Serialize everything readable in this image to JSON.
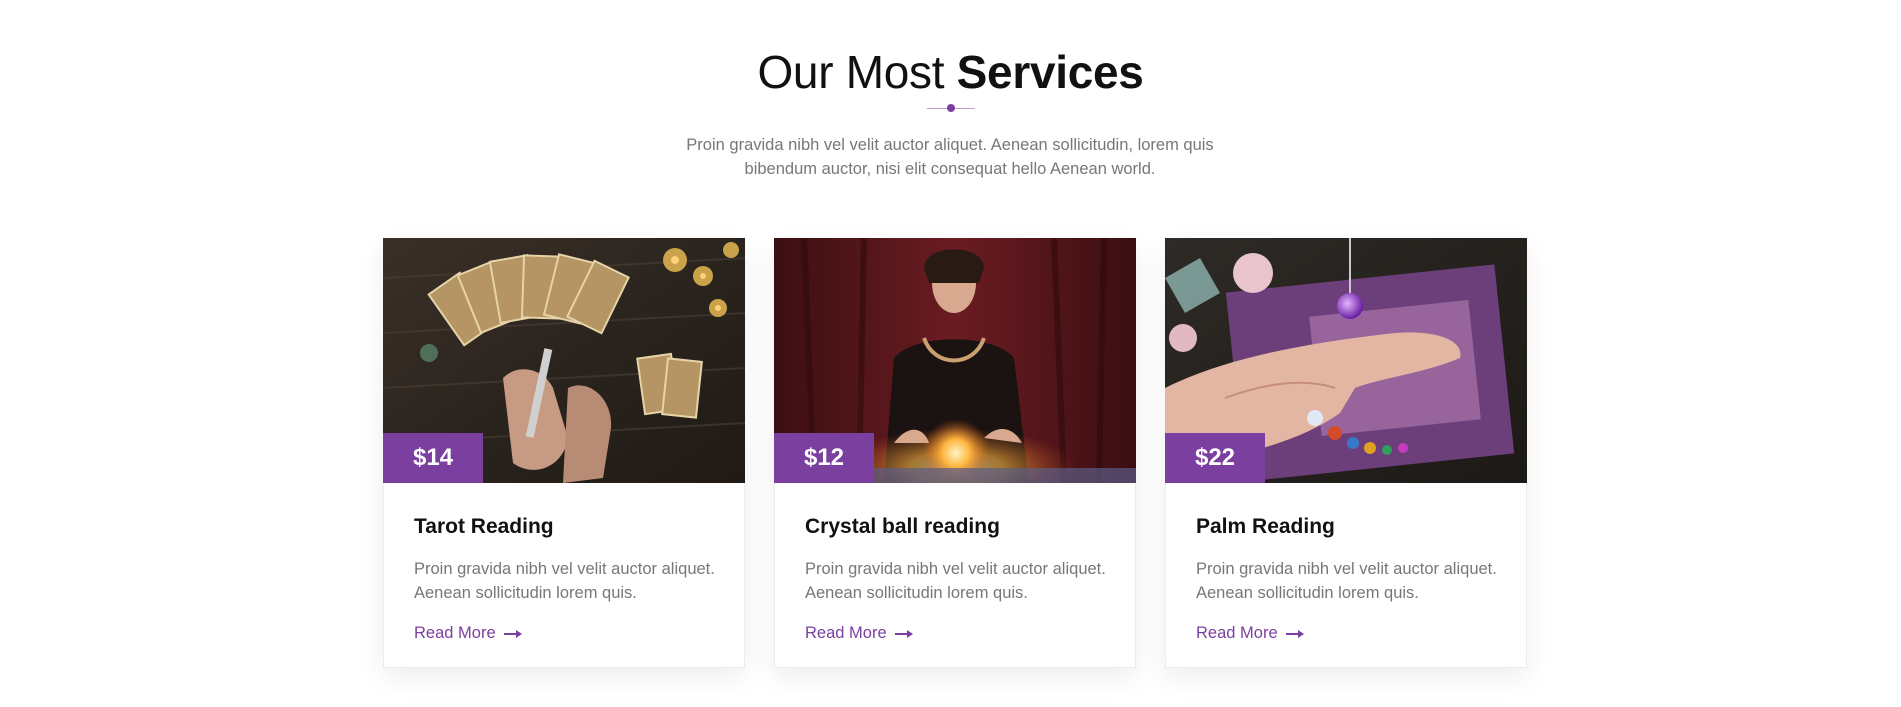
{
  "section": {
    "title_light": "Our Most",
    "title_bold": "Services",
    "intro": "Proin gravida nibh vel velit auctor aliquet. Aenean sollicitudin, lorem quis bibendum auctor, nisi elit consequat hello Aenean world."
  },
  "services": [
    {
      "price": "$14",
      "title": "Tarot Reading",
      "description": "Proin gravida nibh vel velit auctor aliquet. Aenean sollicitudin lorem quis.",
      "link": "Read More",
      "image": "tarot-cards-image"
    },
    {
      "price": "$12",
      "title": "Crystal ball reading",
      "description": "Proin gravida nibh vel velit auctor aliquet. Aenean sollicitudin lorem quis.",
      "link": "Read More",
      "image": "crystal-ball-image"
    },
    {
      "price": "$22",
      "title": "Palm Reading",
      "description": "Proin gravida nibh vel velit auctor aliquet. Aenean sollicitudin lorem quis.",
      "link": "Read More",
      "image": "palm-reading-image"
    }
  ],
  "colors": {
    "accent": "#7b3fa0",
    "heading": "#111111",
    "body_text": "#777777"
  },
  "icons": {
    "divider": "dot-divider-icon",
    "link_arrow": "arrow-right-icon"
  }
}
